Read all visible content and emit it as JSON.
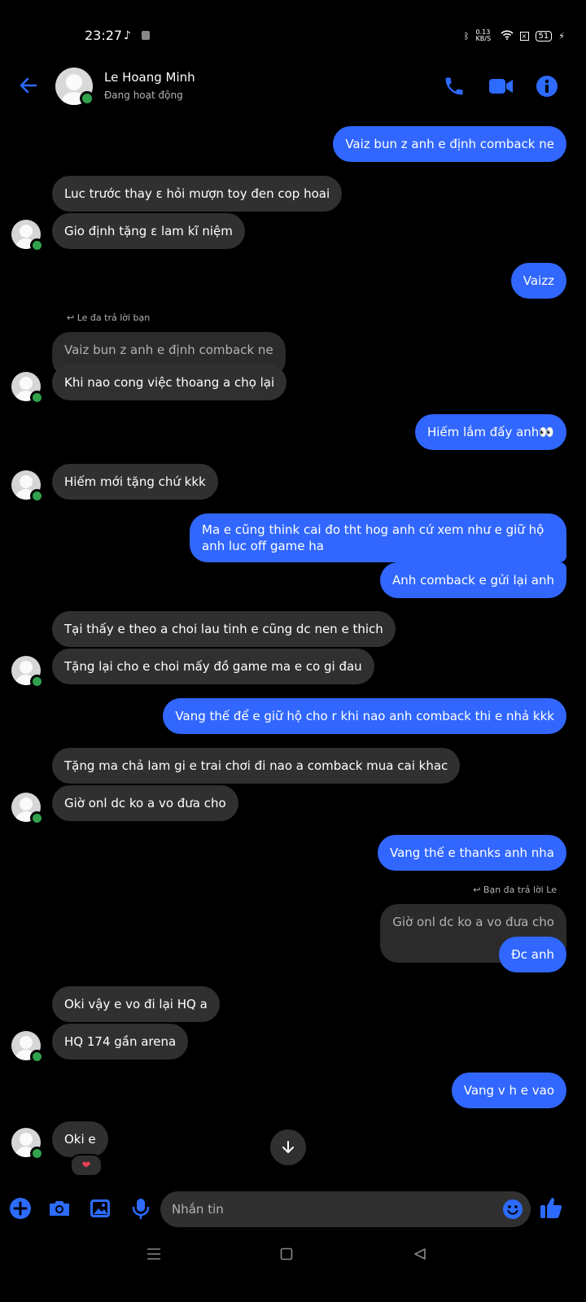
{
  "status_bar": {
    "time": "23:27",
    "net_speed": "0.13 KB/S",
    "battery": "51"
  },
  "header": {
    "name": "Le Hoang Minh",
    "status": "Đang hoạt động"
  },
  "messages": [
    {
      "from": "me",
      "text": "Vaiz bun z anh e định comback ne"
    },
    {
      "from": "them",
      "text": "Luc trước thay ε hỏi mượn toy đen cop hoai"
    },
    {
      "from": "them",
      "text": "Gio định tặng ε lam kĩ niệm"
    },
    {
      "from": "me",
      "text": "Vaizz"
    },
    {
      "from": "them",
      "reply_note": "Le đa trả lời bạn",
      "quoted": "Vaiz bun z anh e định comback ne",
      "text": "Khi nao cong việc thoang a chọ lại"
    },
    {
      "from": "me",
      "text": "Hiếm lắm đấy anh👀"
    },
    {
      "from": "them",
      "text": "Hiếm mới tặng chứ kkk"
    },
    {
      "from": "me",
      "text": "Ma e cũng think cai đo tht hog anh cứ xem như e giữ hộ anh luc off game ha"
    },
    {
      "from": "me",
      "text": "Anh comback e gửi lại anh"
    },
    {
      "from": "them",
      "text": "Tại thấy e theo a choi lau tinh e cũng dc nen e thich"
    },
    {
      "from": "them",
      "text": "Tặng lại cho e choi mấy đồ game ma e co gi đau"
    },
    {
      "from": "me",
      "text": "Vang thế để e giữ hộ cho r khi nao anh comback thi e nhả kkk"
    },
    {
      "from": "them",
      "text": "Tặng ma chả lam gi e trai chơi đi nao a comback mua cai khac"
    },
    {
      "from": "them",
      "text": "Giờ onl dc ko a vo đưa cho"
    },
    {
      "from": "me",
      "text": "Vang thế e thanks anh nha"
    },
    {
      "from": "me",
      "reply_note": "Bạn đa trả lời Le",
      "quoted": "Giờ onl dc ko a vo đưa cho",
      "text": "Đc anh"
    },
    {
      "from": "them",
      "text": "Oki vậy e vo đi lại HQ a"
    },
    {
      "from": "them",
      "text": "HQ 174 gần arena"
    },
    {
      "from": "me",
      "text": "Vang v h e vao"
    },
    {
      "from": "them",
      "text": "Oki e",
      "reaction": "❤"
    }
  ],
  "composer": {
    "placeholder": "Nhắn tin"
  },
  "icons": {
    "back": "arrow-left-icon",
    "call": "phone-icon",
    "video": "video-camera-icon",
    "info": "info-icon",
    "add": "plus-icon",
    "camera": "camera-icon",
    "gallery": "image-icon",
    "mic": "microphone-icon",
    "emoji": "emoji-icon",
    "like": "thumbs-up-icon",
    "scroll": "arrow-down-icon"
  },
  "colors": {
    "accent": "#3167ff",
    "icon_blue": "#2d6bff",
    "incoming_bubble": "#303030",
    "online": "#31a24c",
    "background": "#000000"
  }
}
